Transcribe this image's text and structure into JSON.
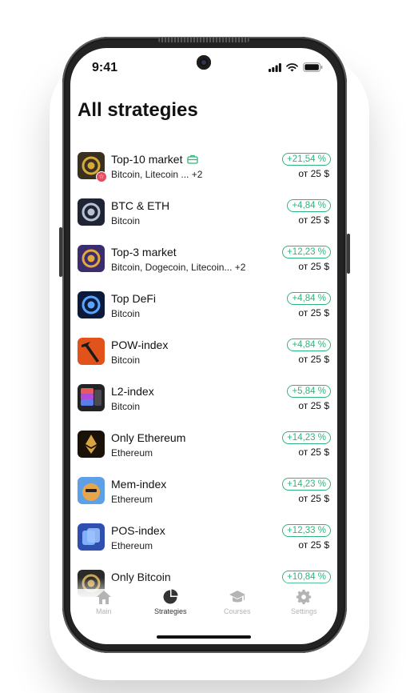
{
  "status_bar": {
    "time": "9:41"
  },
  "page": {
    "title": "All strategies"
  },
  "strategies": [
    {
      "name": "Top-10 market",
      "coins": "Bitcoin, Litecoin ... +2",
      "change": "+21,54 %",
      "price": "от 25 $",
      "thumb_bg": "#3a3020",
      "thumb_fg": "#d6a93a",
      "has_badge": true,
      "has_case_icon": true
    },
    {
      "name": "BTC & ETH",
      "coins": "Bitcoin",
      "change": "+4,84 %",
      "price": "от 25 $",
      "thumb_bg": "#1e2433",
      "thumb_fg": "#b9c2d3"
    },
    {
      "name": "Top-3 market",
      "coins": "Bitcoin, Dogecoin, Litecoin... +2",
      "change": "+12,23 %",
      "price": "от 25 $",
      "thumb_bg": "#3b2c6e",
      "thumb_fg": "#e2a93a"
    },
    {
      "name": "Top DeFi",
      "coins": "Bitcoin",
      "change": "+4,84 %",
      "price": "от 25 $",
      "thumb_bg": "#0b1a3a",
      "thumb_fg": "#5aa4ff"
    },
    {
      "name": "POW-index",
      "coins": "Bitcoin",
      "change": "+4,84 %",
      "price": "от 25 $",
      "thumb_bg": "#e2531c",
      "thumb_fg": "#1a1a1a"
    },
    {
      "name": "L2-index",
      "coins": "Bitcoin",
      "change": "+5,84 %",
      "price": "от 25 $",
      "thumb_bg": "#232326",
      "thumb_fg": "#b04ad8"
    },
    {
      "name": "Only Ethereum",
      "coins": "Ethereum",
      "change": "+14,23 %",
      "price": "от 25 $",
      "thumb_bg": "#1a1208",
      "thumb_fg": "#d9a441"
    },
    {
      "name": "Mem-index",
      "coins": "Ethereum",
      "change": "+14,23 %",
      "price": "от 25 $",
      "thumb_bg": "#5ea0e6",
      "thumb_fg": "#e8a54a"
    },
    {
      "name": "POS-index",
      "coins": "Ethereum",
      "change": "+12,33 %",
      "price": "от 25 $",
      "thumb_bg": "#2f4fb0",
      "thumb_fg": "#7fb0ff"
    },
    {
      "name": "Only Bitcoin",
      "coins": "",
      "change": "+10,84 %",
      "price": "",
      "thumb_bg": "#2a2a2a",
      "thumb_fg": "#c9a556"
    }
  ],
  "tabbar": {
    "tabs": [
      {
        "label": "Main",
        "icon": "home-icon",
        "active": false
      },
      {
        "label": "Strategies",
        "icon": "pie-chart-icon",
        "active": true
      },
      {
        "label": "Courses",
        "icon": "graduation-cap-icon",
        "active": false
      },
      {
        "label": "Settings",
        "icon": "gear-icon",
        "active": false
      }
    ]
  },
  "colors": {
    "accent_green": "#2fb57c",
    "badge_red": "#e84a5f",
    "tab_active": "#333333",
    "tab_inactive": "#b4b4b4"
  }
}
